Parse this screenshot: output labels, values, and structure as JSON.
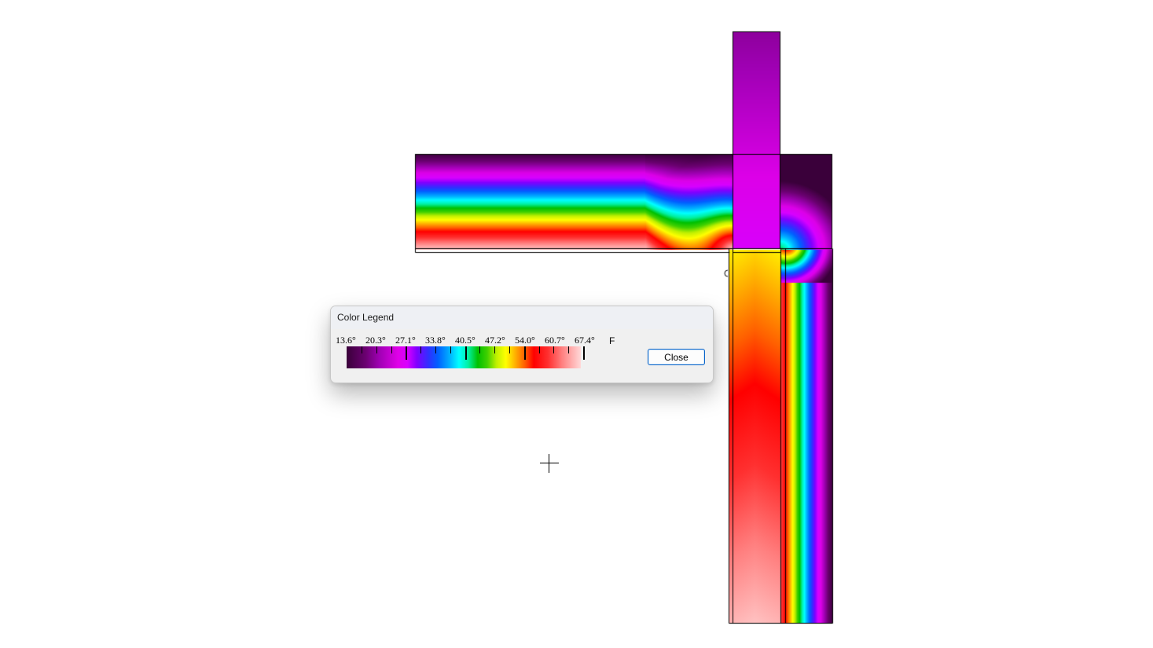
{
  "legend_dialog": {
    "title": "Color Legend",
    "close_label": "Close",
    "unit": "F",
    "tick_labels": [
      "13.6°",
      "20.3°",
      "27.1°",
      "33.8°",
      "40.5°",
      "47.2°",
      "54.0°",
      "60.7°",
      "67.4°"
    ]
  },
  "colors": {
    "dialog_background": "#f0f0f0",
    "button_border": "#0a64c8",
    "model_outline": "#000000"
  },
  "icons": {
    "cursor": "crosshair-cursor-icon"
  }
}
